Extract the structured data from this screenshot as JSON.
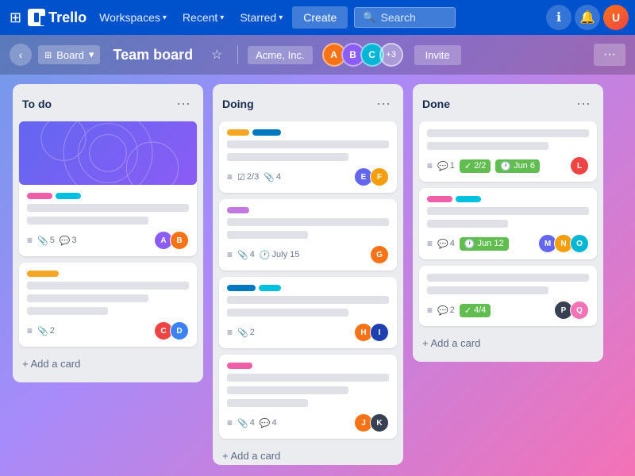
{
  "app": {
    "name": "Trello"
  },
  "topnav": {
    "workspaces_label": "Workspaces",
    "recent_label": "Recent",
    "starred_label": "Starred",
    "create_label": "Create",
    "search_placeholder": "Search",
    "user_initials": "U"
  },
  "subbar": {
    "board_label": "Board",
    "board_title": "Team board",
    "workspace_label": "Acme, Inc.",
    "plus_label": "+3",
    "invite_label": "Invite",
    "more_label": "···"
  },
  "columns": [
    {
      "id": "todo",
      "title": "To do",
      "menu_label": "···",
      "add_card_label": "+ Add a card"
    },
    {
      "id": "doing",
      "title": "Doing",
      "menu_label": "···",
      "add_card_label": "+ Add a card"
    },
    {
      "id": "done",
      "title": "Done",
      "menu_label": "···",
      "add_card_label": "+ Add a card"
    }
  ],
  "doing_card2_date": "July 15",
  "done_card1_badge": "2/2",
  "done_card1_date": "Jun 6",
  "done_card2_count": "4",
  "done_card2_date": "Jun 12",
  "done_card3_badge": "4/4"
}
